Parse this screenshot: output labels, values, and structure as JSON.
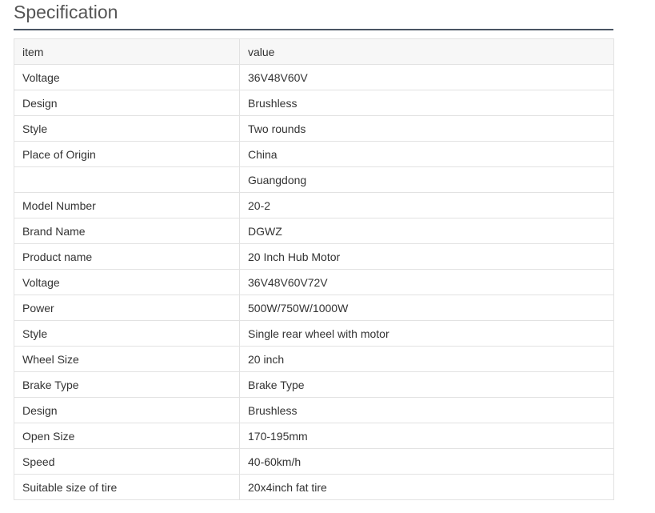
{
  "title": "Specification",
  "header": {
    "item": "item",
    "value": "value"
  },
  "rows": [
    {
      "item": "Voltage",
      "value": "36V48V60V"
    },
    {
      "item": "Design",
      "value": "Brushless"
    },
    {
      "item": "Style",
      "value": "Two rounds"
    },
    {
      "item": "Place of Origin",
      "value": "China"
    },
    {
      "item": "",
      "value": "Guangdong"
    },
    {
      "item": "Model Number",
      "value": "20-2"
    },
    {
      "item": "Brand Name",
      "value": "DGWZ"
    },
    {
      "item": "Product name",
      "value": "20 Inch Hub Motor"
    },
    {
      "item": "Voltage",
      "value": "36V48V60V72V"
    },
    {
      "item": "Power",
      "value": "500W/750W/1000W"
    },
    {
      "item": "Style",
      "value": "Single rear wheel with motor"
    },
    {
      "item": "Wheel Size",
      "value": "20 inch"
    },
    {
      "item": "Brake Type",
      "value": "Brake Type"
    },
    {
      "item": "Design",
      "value": "Brushless"
    },
    {
      "item": "Open Size",
      "value": "170-195mm"
    },
    {
      "item": "Speed",
      "value": "40-60km/h"
    },
    {
      "item": "Suitable size of tire",
      "value": "20x4inch fat tire"
    }
  ]
}
